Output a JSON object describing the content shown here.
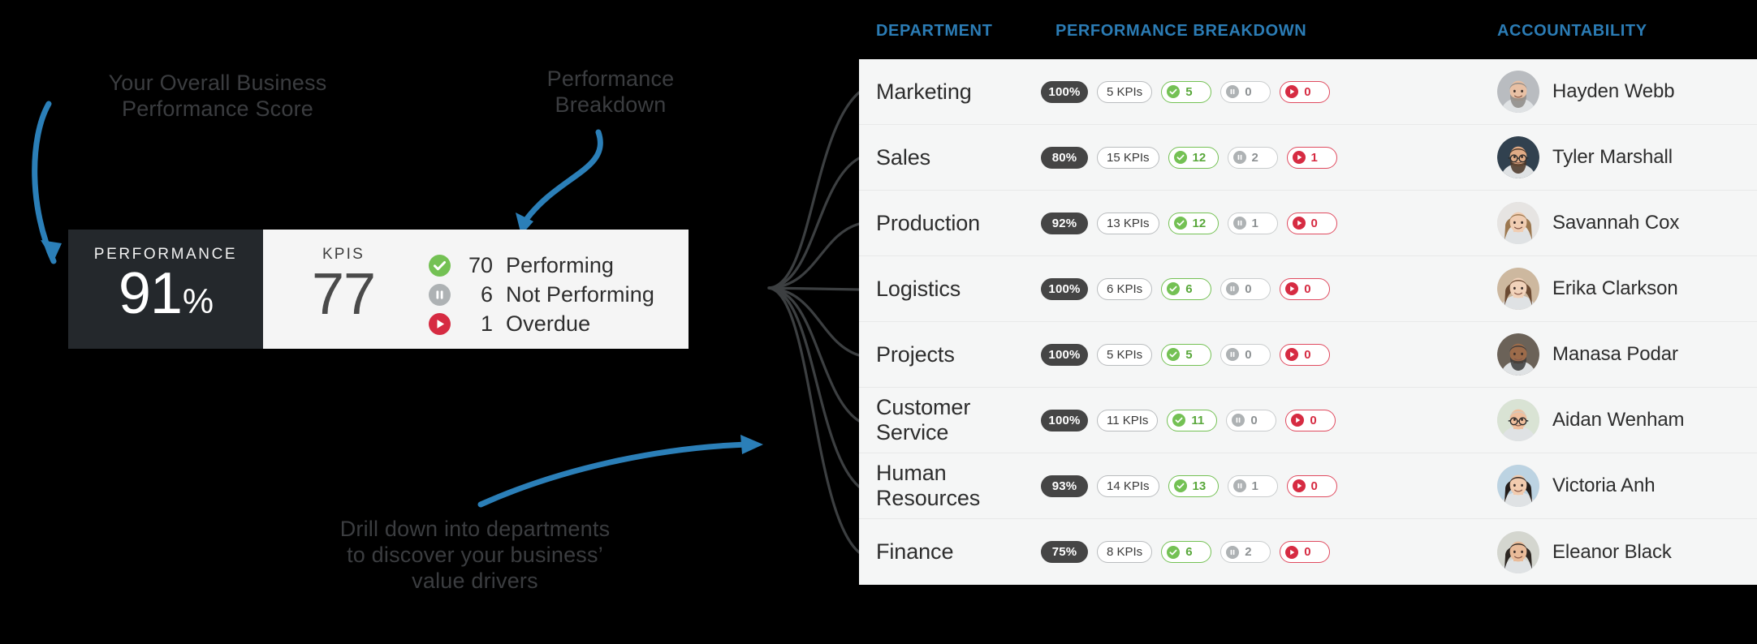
{
  "theme": {
    "accent_blue": "#2b7cb5",
    "dark_panel": "#24282c",
    "light_panel": "#f5f5f5",
    "green": "#74c154",
    "gray": "#aeb2b4",
    "red": "#d62b42",
    "annotation_text": "#3b3d40"
  },
  "annotations": {
    "overall_score": "Your Overall Business\nPerformance Score",
    "performance_breakdown": "Performance\nBreakdown",
    "drill_down": "Drill down into departments\nto discover your business’\nvalue drivers"
  },
  "score_card": {
    "performance_label": "PERFORMANCE",
    "performance_value": "91",
    "performance_unit": "%",
    "kpis_label": "KPIS",
    "kpis_total": "77",
    "legend": [
      {
        "icon": "check-circle-icon",
        "count": "70",
        "label": "Performing",
        "color": "#74c154"
      },
      {
        "icon": "pause-circle-icon",
        "count": "6",
        "label": "Not Performing",
        "color": "#aeb2b4"
      },
      {
        "icon": "play-circle-icon",
        "count": "1",
        "label": "Overdue",
        "color": "#d62b42"
      }
    ]
  },
  "table": {
    "headers": {
      "department": "DEPARTMENT",
      "performance_breakdown": "PERFORMANCE BREAKDOWN",
      "accountability": "ACCOUNTABILITY"
    },
    "rows": [
      {
        "department": "Marketing",
        "percent": "100%",
        "kpis": "5 KPIs",
        "performing": "5",
        "not_performing": "0",
        "overdue": "0",
        "owner": "Hayden Webb"
      },
      {
        "department": "Sales",
        "percent": "80%",
        "kpis": "15 KPIs",
        "performing": "12",
        "not_performing": "2",
        "overdue": "1",
        "owner": "Tyler Marshall"
      },
      {
        "department": "Production",
        "percent": "92%",
        "kpis": "13 KPIs",
        "performing": "12",
        "not_performing": "1",
        "overdue": "0",
        "owner": "Savannah Cox"
      },
      {
        "department": "Logistics",
        "percent": "100%",
        "kpis": "6 KPIs",
        "performing": "6",
        "not_performing": "0",
        "overdue": "0",
        "owner": "Erika Clarkson"
      },
      {
        "department": "Projects",
        "percent": "100%",
        "kpis": "5 KPIs",
        "performing": "5",
        "not_performing": "0",
        "overdue": "0",
        "owner": "Manasa Podar"
      },
      {
        "department": "Customer Service",
        "percent": "100%",
        "kpis": "11 KPIs",
        "performing": "11",
        "not_performing": "0",
        "overdue": "0",
        "owner": "Aidan Wenham"
      },
      {
        "department": "Human Resources",
        "percent": "93%",
        "kpis": "14 KPIs",
        "performing": "13",
        "not_performing": "1",
        "overdue": "0",
        "owner": "Victoria Anh"
      },
      {
        "department": "Finance",
        "percent": "75%",
        "kpis": "8 KPIs",
        "performing": "6",
        "not_performing": "2",
        "overdue": "0",
        "owner": "Eleanor Black"
      }
    ]
  }
}
